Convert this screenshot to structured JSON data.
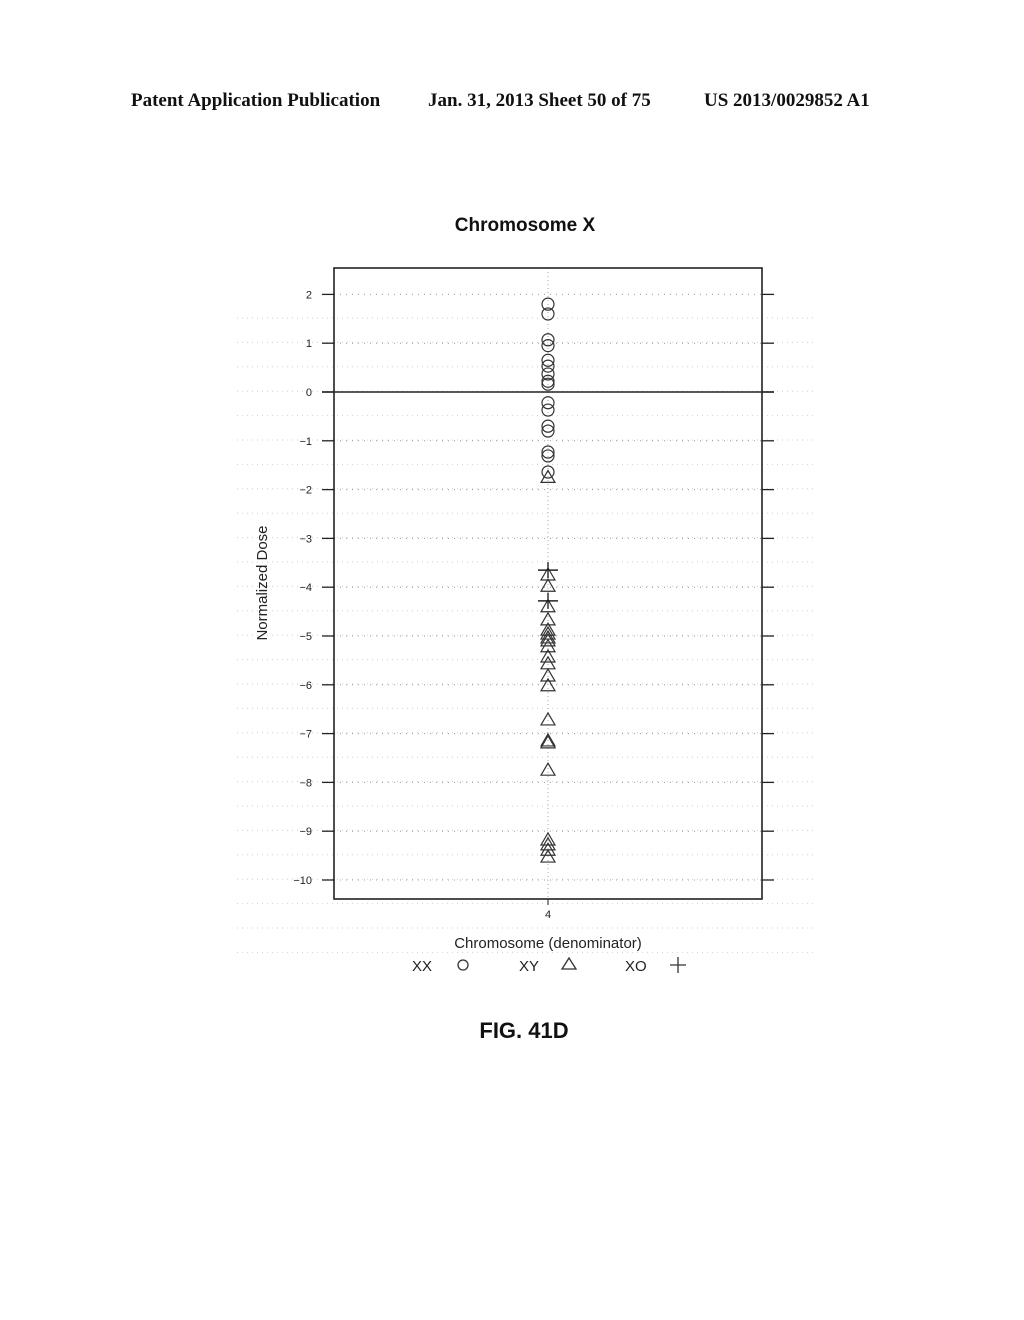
{
  "header": {
    "left": "Patent Application Publication",
    "center": "Jan. 31, 2013  Sheet 50 of 75",
    "right": "US 2013/0029852 A1"
  },
  "figure_label": "FIG. 41D",
  "chart_data": {
    "type": "scatter",
    "title": "Chromosome X",
    "xlabel": "Chromosome (denominator)",
    "ylabel": "Normalized Dose",
    "x_categories": [
      "4"
    ],
    "ylim": [
      -10.3,
      2.5
    ],
    "yticks": [
      2,
      1,
      0,
      -1,
      -2,
      -3,
      -4,
      -5,
      -6,
      -7,
      -8,
      -9,
      -10
    ],
    "ytick_labels": [
      "2",
      "1",
      "0",
      "−1",
      "−2",
      "−3",
      "−4",
      "−5",
      "−6",
      "−7",
      "−8",
      "−9",
      "−10"
    ],
    "reference_line": 0,
    "grid": "dotted",
    "legend_placement": "bottom",
    "series": [
      {
        "name": "XX",
        "marker": "circle",
        "x": "4",
        "values": [
          1.8,
          1.6,
          1.07,
          0.95,
          0.65,
          0.53,
          0.37,
          0.22,
          0.16,
          -0.22,
          -0.37,
          -0.7,
          -0.8,
          -1.23,
          -1.31,
          -1.64
        ]
      },
      {
        "name": "XY",
        "marker": "triangle",
        "x": "4",
        "values": [
          -1.75,
          -3.75,
          -3.98,
          -4.4,
          -4.67,
          -4.88,
          -4.96,
          -5.04,
          -5.1,
          -5.22,
          -5.43,
          -5.57,
          -5.82,
          -6.02,
          -6.72,
          -7.15,
          -7.19,
          -7.75,
          -9.18,
          -9.28,
          -9.39,
          -9.53
        ]
      },
      {
        "name": "XO",
        "marker": "cross",
        "x": "4",
        "values": [
          -3.65,
          -4.28
        ]
      }
    ]
  }
}
